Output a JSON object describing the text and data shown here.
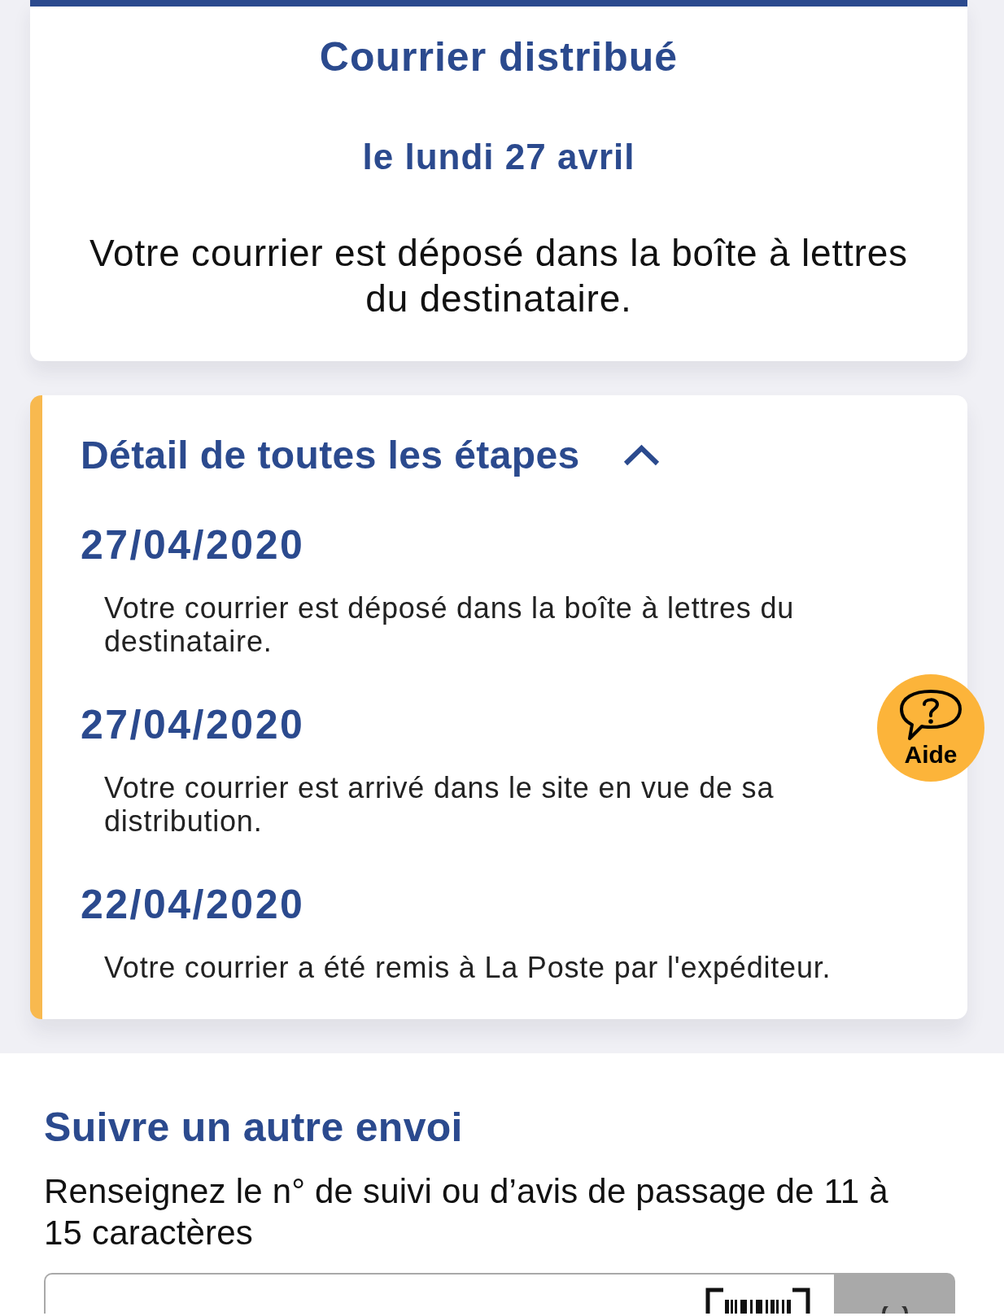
{
  "status_card": {
    "title": "Courrier distribué",
    "date": "le lundi 27 avril",
    "message": "Votre courrier est déposé dans la boîte à lettres du destinataire."
  },
  "steps_panel": {
    "title": "Détail de toutes les étapes",
    "expanded": true,
    "steps": [
      {
        "date": "27/04/2020",
        "description": "Votre courrier est déposé dans la boîte à lettres du destinataire."
      },
      {
        "date": "27/04/2020",
        "description": "Votre courrier est arrivé dans le site en vue de sa distribution."
      },
      {
        "date": "22/04/2020",
        "description": "Votre courrier a été remis à La Poste par l'expéditeur."
      }
    ]
  },
  "help_button": {
    "label": "Aide"
  },
  "tracking_form": {
    "title": "Suivre un autre envoi",
    "instructions": "Renseignez le n° de suivi ou d’avis de passage de 11 à 15 caractères",
    "search_button": {
      "disabled": true
    }
  }
}
